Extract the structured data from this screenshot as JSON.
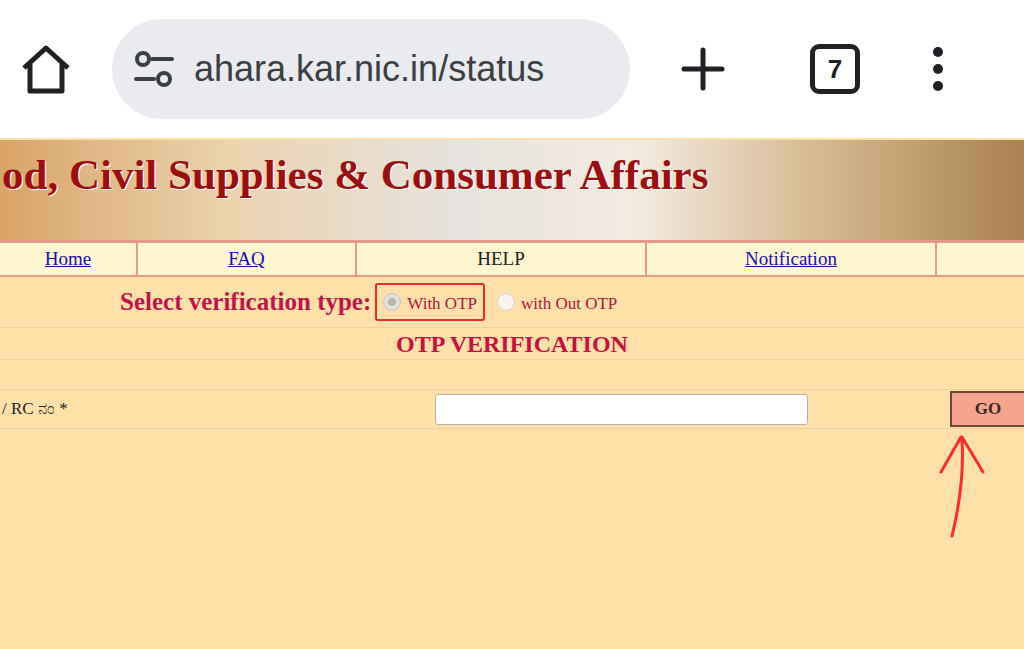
{
  "browser": {
    "url": "ahara.kar.nic.in/status",
    "tab_count": "7"
  },
  "banner": {
    "title": "od, Civil Supplies & Consumer Affairs"
  },
  "nav": [
    {
      "label": "Home",
      "kind": "link"
    },
    {
      "label": "FAQ",
      "kind": "link"
    },
    {
      "label": "HELP",
      "kind": "plain"
    },
    {
      "label": "Notification",
      "kind": "link"
    }
  ],
  "verification": {
    "label": "Select verification type:",
    "options": [
      {
        "label": "With OTP",
        "selected": true,
        "highlighted": true
      },
      {
        "label": "with Out OTP",
        "selected": false,
        "highlighted": false
      }
    ]
  },
  "heading": "OTP VERIFICATION",
  "field": {
    "label": "/ RC ನಂ *",
    "value": ""
  },
  "button": "GO"
}
